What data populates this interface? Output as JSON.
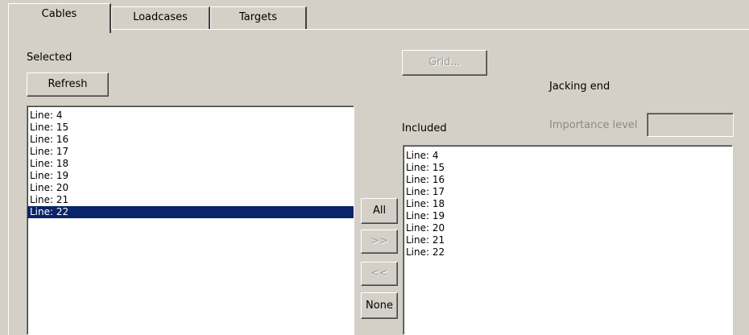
{
  "tabs": [
    {
      "label": "Cables",
      "active": true
    },
    {
      "label": "Loadcases",
      "active": false
    },
    {
      "label": "Targets",
      "active": false
    }
  ],
  "left": {
    "selected_label": "Selected",
    "refresh_label": "Refresh",
    "items": [
      "Line: 4",
      "Line: 15",
      "Line: 16",
      "Line: 17",
      "Line: 18",
      "Line: 19",
      "Line: 20",
      "Line: 21",
      "Line: 22"
    ],
    "selected_item": "Line: 22"
  },
  "middle": {
    "all_label": "All",
    "add_label": ">>",
    "remove_label": "<<",
    "none_label": "None"
  },
  "right": {
    "grid_label": "Grid...",
    "jacking_end_label": "Jacking end",
    "included_label": "Included",
    "importance_label": "Importance level",
    "importance_value": "",
    "items": [
      "Line: 4",
      "Line: 15",
      "Line: 16",
      "Line: 17",
      "Line: 18",
      "Line: 19",
      "Line: 20",
      "Line: 21",
      "Line: 22"
    ]
  },
  "colors": {
    "background": "#d4d0c8",
    "selection": "#0a246a"
  }
}
